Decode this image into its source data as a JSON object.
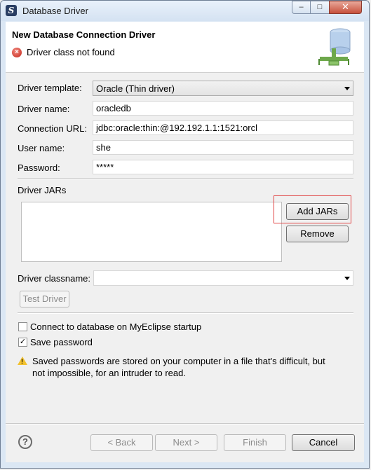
{
  "window": {
    "title": "Database Driver",
    "controls": {
      "minimize": "–",
      "maximize": "□",
      "close": "✕"
    }
  },
  "header": {
    "title": "New Database Connection Driver",
    "message": "Driver class not found",
    "message_icon": "error-icon",
    "banner_icon": "database-icon"
  },
  "form": {
    "driver_template": {
      "label": "Driver template:",
      "value": "Oracle (Thin driver)"
    },
    "driver_name": {
      "label": "Driver name:",
      "value": "oracledb"
    },
    "connection_url": {
      "label": "Connection URL:",
      "value": "jdbc:oracle:thin:@192.192.1.1:1521:orcl"
    },
    "user_name": {
      "label": "User name:",
      "value": "she"
    },
    "password": {
      "label": "Password:",
      "value": "*****"
    },
    "driver_jars": {
      "label": "Driver JARs",
      "items": []
    },
    "driver_classname": {
      "label": "Driver classname:",
      "value": ""
    }
  },
  "buttons": {
    "add_jars": "Add JARs",
    "remove": "Remove",
    "test_driver": "Test Driver",
    "back": "< Back",
    "next": "Next >",
    "finish": "Finish",
    "cancel": "Cancel",
    "help": "?"
  },
  "options": {
    "connect_on_startup": {
      "label": "Connect to database on MyEclipse startup",
      "checked": false
    },
    "save_password": {
      "label": "Save password",
      "checked": true
    }
  },
  "warning": {
    "icon": "warning-icon",
    "line1": "Saved passwords are stored on your computer in a file that's difficult, but",
    "line2": "not impossible, for an intruder to read."
  },
  "colors": {
    "highlight_border": "#e14646",
    "error_icon": "#c42418",
    "warning_icon": "#f2c12e"
  }
}
